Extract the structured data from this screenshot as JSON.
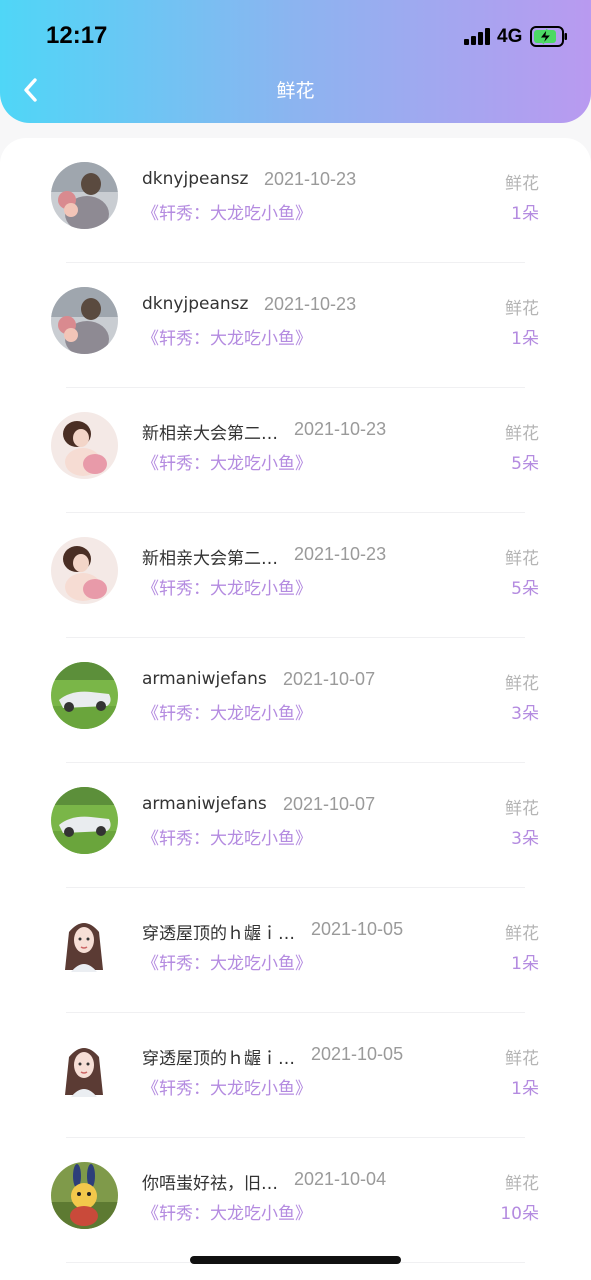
{
  "status_bar": {
    "time": "12:17",
    "network": "4G"
  },
  "nav": {
    "title": "鲜花"
  },
  "records": [
    {
      "name": "dknyjpeansz",
      "date": "2021-10-23",
      "gift": "《轩秀：大龙吃小鱼》",
      "label": "鲜花",
      "count": "1朵",
      "avatar": "avatar-1"
    },
    {
      "name": "dknyjpeansz",
      "date": "2021-10-23",
      "gift": "《轩秀：大龙吃小鱼》",
      "label": "鲜花",
      "count": "1朵",
      "avatar": "avatar-1"
    },
    {
      "name": "新相亲大会第二…",
      "date": "2021-10-23",
      "gift": "《轩秀：大龙吃小鱼》",
      "label": "鲜花",
      "count": "5朵",
      "avatar": "avatar-2"
    },
    {
      "name": "新相亲大会第二…",
      "date": "2021-10-23",
      "gift": "《轩秀：大龙吃小鱼》",
      "label": "鲜花",
      "count": "5朵",
      "avatar": "avatar-2"
    },
    {
      "name": "armaniwjefans",
      "date": "2021-10-07",
      "gift": "《轩秀：大龙吃小鱼》",
      "label": "鲜花",
      "count": "3朵",
      "avatar": "avatar-3"
    },
    {
      "name": "armaniwjefans",
      "date": "2021-10-07",
      "gift": "《轩秀：大龙吃小鱼》",
      "label": "鲜花",
      "count": "3朵",
      "avatar": "avatar-3"
    },
    {
      "name": "穿透屋顶的ｈ龌ｉ…",
      "date": "2021-10-05",
      "gift": "《轩秀：大龙吃小鱼》",
      "label": "鲜花",
      "count": "1朵",
      "avatar": "avatar-4"
    },
    {
      "name": "穿透屋顶的ｈ龌ｉ…",
      "date": "2021-10-05",
      "gift": "《轩秀：大龙吃小鱼》",
      "label": "鲜花",
      "count": "1朵",
      "avatar": "avatar-4"
    },
    {
      "name": "你唔蚩好祛，旧…",
      "date": "2021-10-04",
      "gift": "《轩秀：大龙吃小鱼》",
      "label": "鲜花",
      "count": "10朵",
      "avatar": "avatar-5"
    }
  ]
}
